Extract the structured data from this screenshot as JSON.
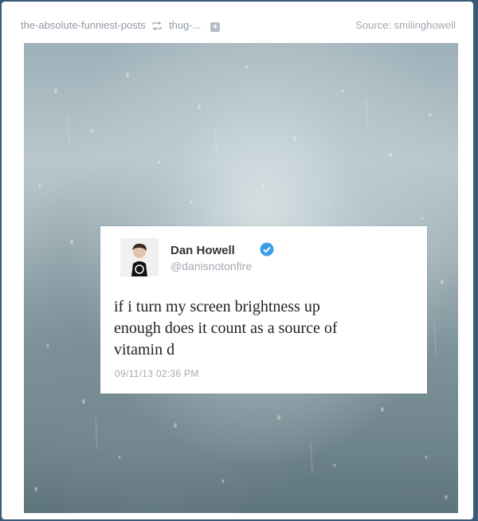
{
  "header": {
    "blog_name": "the-absolute-funniest-posts",
    "reblog_icon": "reblog-icon",
    "reblogged_from": "thug-...",
    "expand_icon": "plus-icon",
    "source_label": "Source: smilinghowell"
  },
  "tweet": {
    "display_name": "Dan Howell",
    "handle": "@danisnotonfire",
    "verified_icon": "verified-badge-icon",
    "text_line1": "if i turn my screen brightness up",
    "text_line2": "enough does it count as a source of",
    "text_line3": "vitamin d",
    "timestamp": "09/11/13 02:36 PM"
  },
  "colors": {
    "page_background": "#3a5a78",
    "verified_blue": "#3b9fe8"
  }
}
